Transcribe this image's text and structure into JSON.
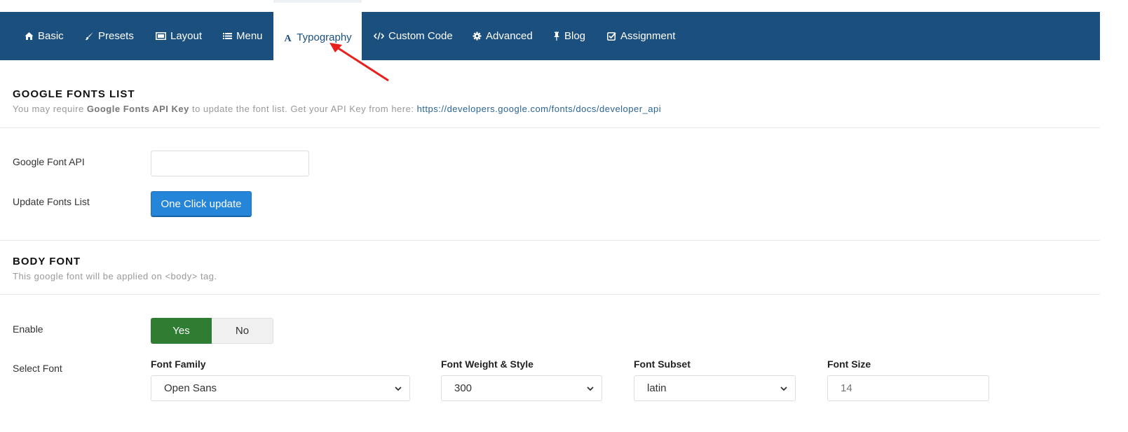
{
  "tabs": [
    {
      "label": "Basic",
      "icon": "home-icon"
    },
    {
      "label": "Presets",
      "icon": "paintbrush-icon"
    },
    {
      "label": "Layout",
      "icon": "layout-icon"
    },
    {
      "label": "Menu",
      "icon": "list-icon"
    },
    {
      "label": "Typography",
      "icon": "font-icon",
      "active": true
    },
    {
      "label": "Custom Code",
      "icon": "code-icon"
    },
    {
      "label": "Advanced",
      "icon": "gear-icon"
    },
    {
      "label": "Blog",
      "icon": "pin-icon"
    },
    {
      "label": "Assignment",
      "icon": "check-square-icon"
    }
  ],
  "google_fonts": {
    "title": "GOOGLE FONTS LIST",
    "desc_prefix": "You may require ",
    "desc_bold": "Google Fonts API Key",
    "desc_middle": " to update the font list. Get your API Key from here: ",
    "desc_link": "https://developers.google.com/fonts/docs/developer_api",
    "api_label": "Google Font API",
    "api_value": "",
    "update_label": "Update Fonts List",
    "update_button": "One Click update"
  },
  "body_font": {
    "title": "BODY FONT",
    "desc": "This google font will be applied on <body> tag.",
    "enable_label": "Enable",
    "enable_yes": "Yes",
    "enable_no": "No",
    "enable_selected": "Yes",
    "select_font_label": "Select Font",
    "font_family_label": "Font Family",
    "font_family_value": "Open Sans",
    "font_weight_label": "Font Weight & Style",
    "font_weight_value": "300",
    "font_subset_label": "Font Subset",
    "font_subset_value": "latin",
    "font_size_label": "Font Size",
    "font_size_placeholder": "14"
  },
  "colors": {
    "tabbar": "#1b4f7e",
    "primary_button": "#2585d8",
    "toggle_yes": "#2e7d32",
    "annotation_arrow": "#e8201e"
  }
}
